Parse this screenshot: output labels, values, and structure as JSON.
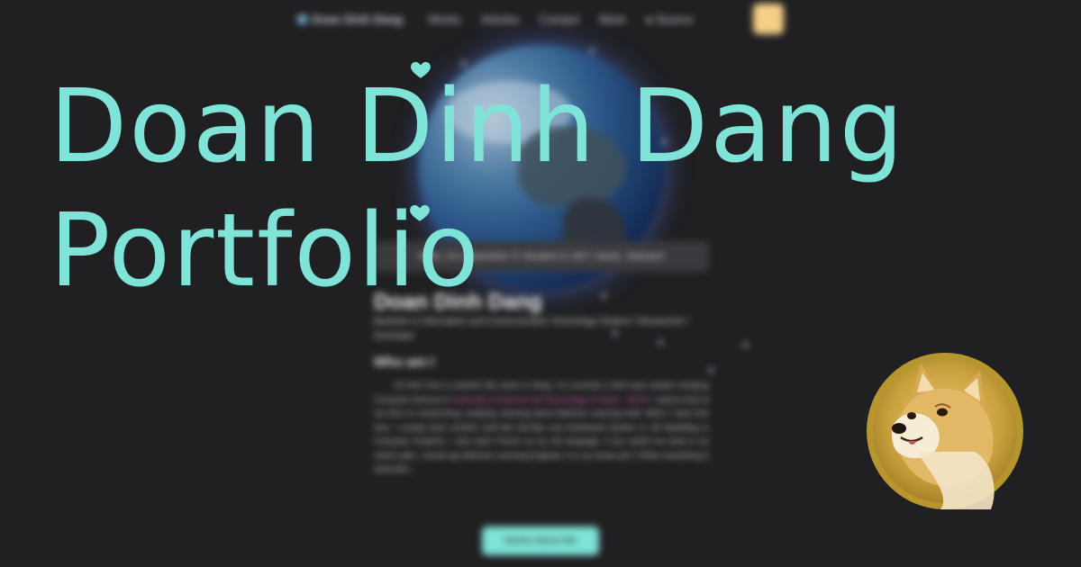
{
  "headline": {
    "line1": "Doan Dinh Dang",
    "line2": "Portfolio"
  },
  "background_site": {
    "nav": {
      "brand": "Doan Dinh Dang",
      "items": [
        "Works",
        "Articles",
        "Contact",
        "More",
        "Source"
      ]
    },
    "hello_text": "Hello, I'm a Bachelor IT Student in UET, Hanoi, Vietnam!",
    "profile": {
      "name": "Doan Dinh Dang",
      "role": "Bachelor in Information and Communication Technology Student / Researcher / Developer"
    },
    "about": {
      "title": "Who am I",
      "text_before": "Hi! Dinh from a student! My name is Dang. I'm currently a third year student studying Computer Science in ",
      "text_highlight": "University of Science and Technology of Hanoi - USTH",
      "text_after": ". I spend most of my time on researching, studying, learning about Machine Learning stuff. When I have free time, I usually learn another stuff like DevOps and Distributed System or 3D Modelling in Computer Graphics. I also learn French as my 3rd language. If you asked me what is my carrier path, I would say Machine Learning Engineer. It is my dream job !! When everything is automatic..."
    },
    "works_button": "Works About Me"
  },
  "colors": {
    "accent": "#7fe3d7",
    "background": "#202023",
    "highlight": "#e668b6",
    "toggle": "#f5cf86"
  },
  "icons": {
    "brand": "globe-logo-icon",
    "source": "github-icon",
    "toggle": "sun-icon",
    "badge": "doge-coin-icon"
  }
}
